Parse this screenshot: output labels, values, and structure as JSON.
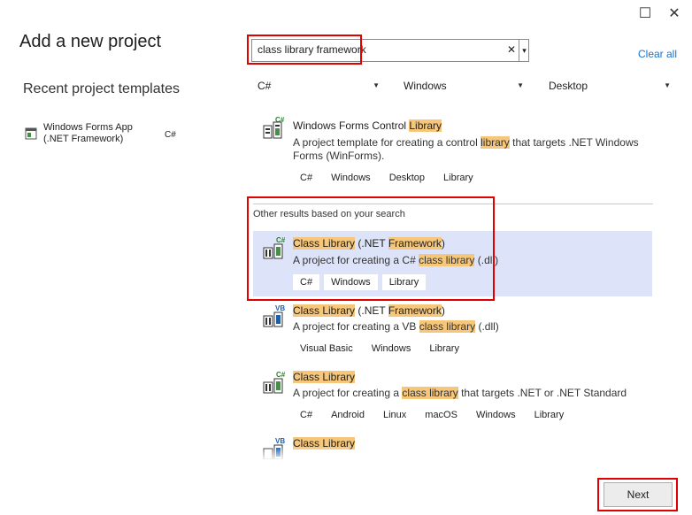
{
  "window": {
    "maximize_glyph": "☐",
    "close_glyph": "✕"
  },
  "page_title": "Add a new project",
  "recent": {
    "heading": "Recent project templates",
    "items": [
      {
        "name": "Windows Forms App (.NET Framework)",
        "lang": "C#"
      }
    ]
  },
  "search": {
    "value": "class library framework",
    "clear_glyph": "✕",
    "dropdown_glyph": "▾"
  },
  "clear_all": "Clear all",
  "filters": [
    {
      "value": "C#"
    },
    {
      "value": "Windows"
    },
    {
      "value": "Desktop"
    }
  ],
  "templates_top": [
    {
      "title_parts": [
        "Windows Forms Control ",
        "Library"
      ],
      "desc_parts": [
        "A project template for creating a control ",
        "library",
        " that targets .NET Windows Forms (WinForms)."
      ],
      "tags": [
        "C#",
        "Windows",
        "Desktop",
        "Library"
      ],
      "badge": "C#"
    }
  ],
  "other_results_heading": "Other results based on your search",
  "templates_other": [
    {
      "title_parts": [
        "Class Library",
        " (.NET ",
        "Framework",
        ")"
      ],
      "desc_parts": [
        "A project for creating a C# ",
        "class library",
        " (.dll)"
      ],
      "tags": [
        "C#",
        "Windows",
        "Library"
      ],
      "badge": "C#"
    },
    {
      "title_parts": [
        "Class Library",
        " (.NET ",
        "Framework",
        ")"
      ],
      "desc_parts": [
        "A project for creating a VB ",
        "class library",
        " (.dll)"
      ],
      "tags": [
        "Visual Basic",
        "Windows",
        "Library"
      ],
      "badge": "VB"
    },
    {
      "title_parts": [
        "Class Library"
      ],
      "desc_parts": [
        "A project for creating a ",
        "class library",
        " that targets .NET or .NET Standard"
      ],
      "tags": [
        "C#",
        "Android",
        "Linux",
        "macOS",
        "Windows",
        "Library"
      ],
      "badge": "C#"
    },
    {
      "title_parts": [
        "Class Library"
      ],
      "badge": "VB"
    }
  ],
  "next_button": "Next",
  "colors": {
    "highlight": "#f6c77a",
    "selected": "#dde3f8",
    "red_outline": "#e00000",
    "link": "#1a73c9"
  }
}
